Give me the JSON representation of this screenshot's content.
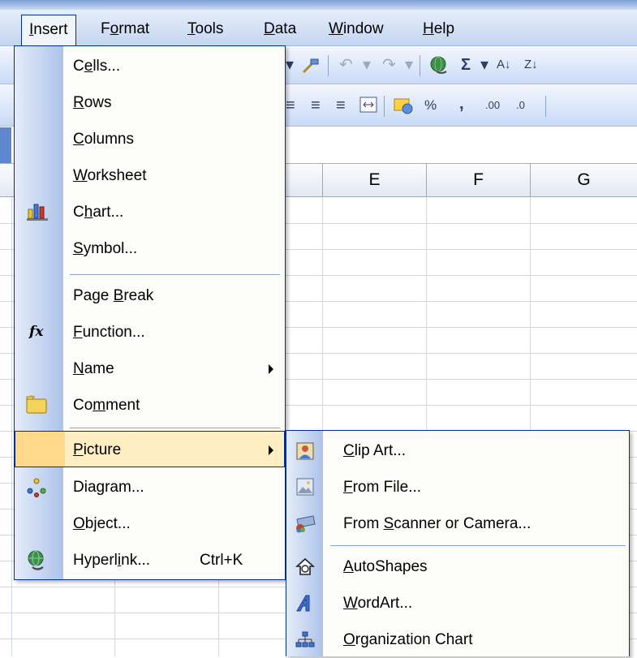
{
  "menubar": {
    "items": [
      {
        "label_pre": "",
        "mn": "I",
        "label_post": "nsert"
      },
      {
        "label_pre": "F",
        "mn": "o",
        "label_post": "rmat"
      },
      {
        "label_pre": "",
        "mn": "T",
        "label_post": "ools"
      },
      {
        "label_pre": "",
        "mn": "D",
        "label_post": "ata"
      },
      {
        "label_pre": "",
        "mn": "W",
        "label_post": "indow"
      },
      {
        "label_pre": "",
        "mn": "H",
        "label_post": "elp"
      }
    ]
  },
  "toolbar": {
    "sigma": "Σ",
    "percent": "%",
    "comma": ",",
    "sort_asc": "A↓",
    "sort_desc": "Z↓",
    "inc_decimal": ".00",
    "dec_decimal": ".0"
  },
  "columns": [
    "E",
    "F",
    "G"
  ],
  "insert_menu": {
    "items": [
      {
        "pre": "C",
        "mn": "e",
        "post": "lls...",
        "icon": ""
      },
      {
        "pre": "",
        "mn": "R",
        "post": "ows",
        "icon": ""
      },
      {
        "pre": "",
        "mn": "C",
        "post": "olumns",
        "icon": ""
      },
      {
        "pre": "",
        "mn": "W",
        "post": "orksheet",
        "icon": ""
      },
      {
        "pre": "C",
        "mn": "h",
        "post": "art...",
        "icon": "chart-icon"
      },
      {
        "pre": "",
        "mn": "S",
        "post": "ymbol...",
        "icon": ""
      },
      {
        "pre": "Page ",
        "mn": "B",
        "post": "reak",
        "icon": ""
      },
      {
        "pre": "",
        "mn": "F",
        "post": "unction...",
        "icon": "function-icon"
      },
      {
        "pre": "",
        "mn": "N",
        "post": "ame",
        "icon": ""
      },
      {
        "pre": "Co",
        "mn": "m",
        "post": "ment",
        "icon": "comment-icon"
      },
      {
        "pre": "",
        "mn": "P",
        "post": "icture",
        "icon": ""
      },
      {
        "pre": "Dia",
        "mn": "g",
        "post": "ram...",
        "icon": "diagram-icon"
      },
      {
        "pre": "",
        "mn": "O",
        "post": "bject...",
        "icon": ""
      },
      {
        "pre": "Hyperl",
        "mn": "i",
        "post": "nk...",
        "icon": "hyperlink-icon",
        "shortcut": "Ctrl+K"
      }
    ]
  },
  "picture_submenu": {
    "items": [
      {
        "pre": "",
        "mn": "C",
        "post": "lip Art...",
        "icon": "clip-art-icon"
      },
      {
        "pre": "",
        "mn": "F",
        "post": "rom File...",
        "icon": "picture-file-icon"
      },
      {
        "pre": "From ",
        "mn": "S",
        "post": "canner or Camera...",
        "icon": "scanner-icon"
      },
      {
        "pre": "",
        "mn": "A",
        "post": "utoShapes",
        "icon": "autoshapes-icon"
      },
      {
        "pre": "",
        "mn": "W",
        "post": "ordArt...",
        "icon": "wordart-icon"
      },
      {
        "pre": "",
        "mn": "O",
        "post": "rganization Chart",
        "icon": "org-chart-icon"
      }
    ]
  },
  "colors": {
    "menu_border": "#002d96",
    "highlight": "#ffeec2",
    "gutter": "#aec3ea"
  }
}
